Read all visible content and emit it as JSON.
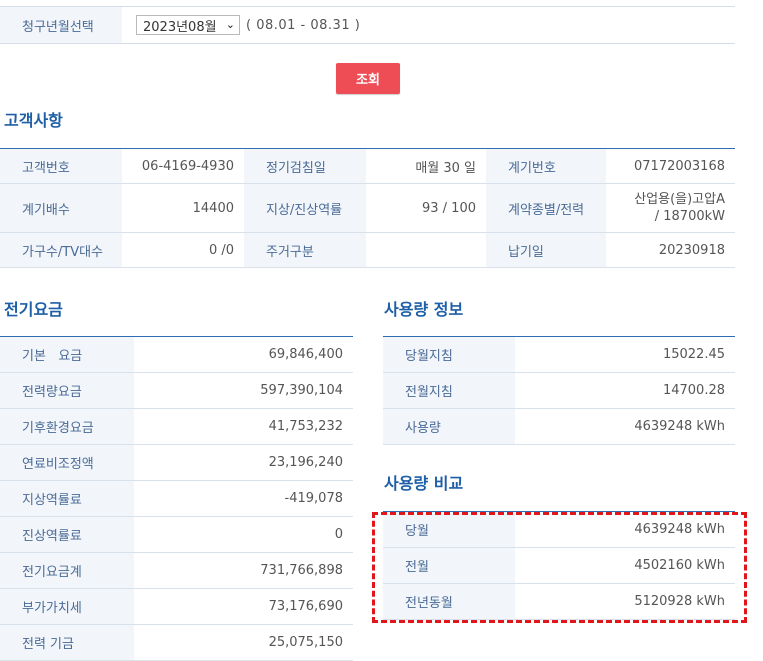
{
  "period": {
    "label": "청구년월선택",
    "selected": "2023년08월",
    "range": "( 08.01 - 08.31 )"
  },
  "search_button": "조회",
  "customer": {
    "title": "고객사항",
    "rows": [
      {
        "l1": "고객번호",
        "v1": "06-4169-4930",
        "l2": "정기검침일",
        "v2": "매월 30 일",
        "l3": "계기번호",
        "v3a": "07172003168",
        "v3b": ""
      },
      {
        "l1": "계기배수",
        "v1": "14400",
        "l2": "지상/진상역률",
        "v2": "93 / 100",
        "l3": "계약종별/전력",
        "v3a": "산업용(을)고압A",
        "v3b": "/ 18700kW"
      },
      {
        "l1": "가구수/TV대수",
        "v1": "0 /0",
        "l2": "주거구분",
        "v2": "",
        "l3": "납기일",
        "v3a": "20230918",
        "v3b": ""
      }
    ]
  },
  "fee": {
    "title": "전기요금",
    "rows": [
      {
        "label": "기본   요금",
        "value": "69,846,400"
      },
      {
        "label": "전력량요금",
        "value": "597,390,104"
      },
      {
        "label": "기후환경요금",
        "value": "41,753,232"
      },
      {
        "label": "연료비조정액",
        "value": "23,196,240"
      },
      {
        "label": "지상역률료",
        "value": "-419,078"
      },
      {
        "label": "진상역률료",
        "value": "0"
      },
      {
        "label": "전기요금계",
        "value": "731,766,898"
      },
      {
        "label": "부가가치세",
        "value": "73,176,690"
      },
      {
        "label": "전력 기금",
        "value": "25,075,150"
      }
    ]
  },
  "usage": {
    "title": "사용량 정보",
    "rows": [
      {
        "label": "당월지침",
        "value": "15022.45"
      },
      {
        "label": "전월지침",
        "value": "14700.28"
      },
      {
        "label": "사용량",
        "value": "4639248 kWh"
      }
    ]
  },
  "compare": {
    "title": "사용량 비교",
    "rows": [
      {
        "label": "당월",
        "value": "4639248 kWh"
      },
      {
        "label": "전월",
        "value": "4502160 kWh"
      },
      {
        "label": "전년동월",
        "value": "5120928 kWh"
      }
    ]
  },
  "colors": {
    "accent": "#1f5fa6",
    "button": "#ef4d55",
    "highlight": "#e0161b"
  }
}
